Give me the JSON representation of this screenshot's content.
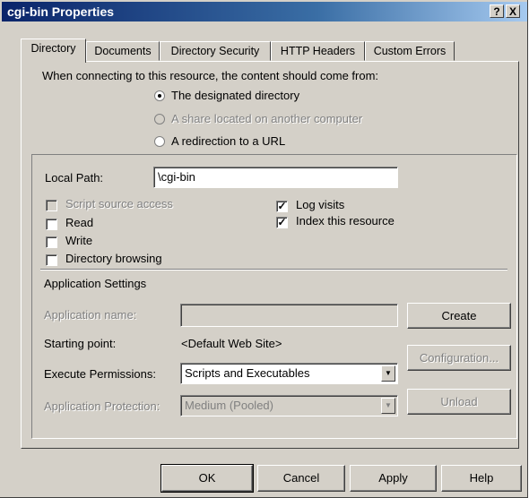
{
  "window": {
    "title": "cgi-bin Properties",
    "help_btn": "?",
    "close_btn": "X"
  },
  "tabs": [
    "Directory",
    "Documents",
    "Directory Security",
    "HTTP Headers",
    "Custom Errors"
  ],
  "content_source": {
    "prompt": "When connecting to this resource, the content should come from:",
    "opt_directory": "The designated directory",
    "opt_share": "A share located on another computer",
    "opt_redirect": "A redirection to a URL"
  },
  "local_path": {
    "label": "Local Path:",
    "value": "\\cgi-bin"
  },
  "perms": {
    "script_source": "Script source access",
    "read": "Read",
    "write": "Write",
    "dir_browsing": "Directory browsing",
    "log_visits": "Log visits",
    "index_resource": "Index this resource"
  },
  "app": {
    "section": "Application Settings",
    "name_label": "Application name:",
    "name_value": "",
    "create_btn": "Create",
    "start_label": "Starting point:",
    "start_value": "<Default Web Site>",
    "config_btn": "Configuration...",
    "exec_label": "Execute Permissions:",
    "exec_value": "Scripts and Executables",
    "prot_label": "Application Protection:",
    "prot_value": "Medium (Pooled)",
    "unload_btn": "Unload"
  },
  "buttons": {
    "ok": "OK",
    "cancel": "Cancel",
    "apply": "Apply",
    "help": "Help"
  }
}
